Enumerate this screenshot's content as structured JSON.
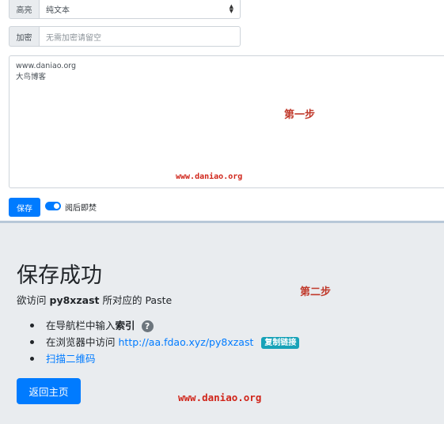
{
  "form": {
    "highlight": {
      "label": "高亮",
      "value": "纯文本"
    },
    "encrypt": {
      "label": "加密",
      "placeholder": "无需加密请留空"
    },
    "content_lines": [
      "www.daniao.org",
      "大鸟博客"
    ],
    "save_label": "保存",
    "burn_after_read_label": "阅后即焚"
  },
  "annotations": {
    "step1": "第一步",
    "step2": "第二步",
    "watermark_top": "www.daniao.org",
    "watermark_bottom": "www.daniao.org"
  },
  "result": {
    "title": "保存成功",
    "visit_prefix": "欲访问",
    "paste_id": "py8xzast",
    "visit_suffix": "所对应的 Paste",
    "bullet1_prefix": "在导航栏中输入",
    "bullet1_bold": "索引",
    "help_icon": "?",
    "bullet2_prefix": "在浏览器中访问",
    "url": "http://aa.fdao.xyz/py8xzast",
    "copy_badge": "复制链接",
    "qr_link": "扫描二维码",
    "home_button": "返回主页"
  },
  "colors": {
    "primary": "#007bff",
    "badge": "#17a2b8",
    "annotation_red": "#c0392b",
    "panel_bg": "#e9ecef"
  }
}
